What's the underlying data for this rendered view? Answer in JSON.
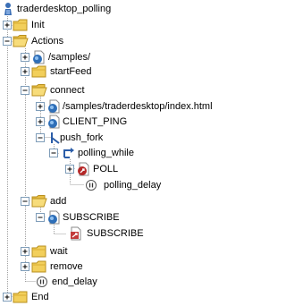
{
  "tree": {
    "root": {
      "label": "traderdesktop_polling",
      "icon": "script-icon"
    },
    "items": [
      {
        "label": "Init",
        "icon": "folder-icon",
        "expanded": false
      },
      {
        "label": "Actions",
        "icon": "folder-icon",
        "expanded": true
      },
      {
        "label": "/samples/",
        "icon": "request-icon",
        "expanded": false
      },
      {
        "label": "startFeed",
        "icon": "folder-icon",
        "expanded": false
      },
      {
        "label": "connect",
        "icon": "folder-icon",
        "expanded": true
      },
      {
        "label": "/samples/traderdesktop/index.html",
        "icon": "request-icon",
        "expanded": false
      },
      {
        "label": "CLIENT_PING",
        "icon": "request-icon",
        "expanded": false
      },
      {
        "label": "push_fork",
        "icon": "fork-icon",
        "expanded": true
      },
      {
        "label": "polling_while",
        "icon": "loop-icon",
        "expanded": true
      },
      {
        "label": "POLL",
        "icon": "poll-request-icon",
        "expanded": false
      },
      {
        "label": "polling_delay",
        "icon": "delay-icon"
      },
      {
        "label": "add",
        "icon": "folder-icon",
        "expanded": true
      },
      {
        "label": "SUBSCRIBE",
        "icon": "request-icon",
        "expanded": true
      },
      {
        "label": "SUBSCRIBE",
        "icon": "subscribe-response-icon"
      },
      {
        "label": "wait",
        "icon": "folder-icon",
        "expanded": false
      },
      {
        "label": "remove",
        "icon": "folder-icon",
        "expanded": false
      },
      {
        "label": "end_delay",
        "icon": "delay-icon"
      },
      {
        "label": "End",
        "icon": "folder-icon",
        "expanded": false
      }
    ]
  }
}
